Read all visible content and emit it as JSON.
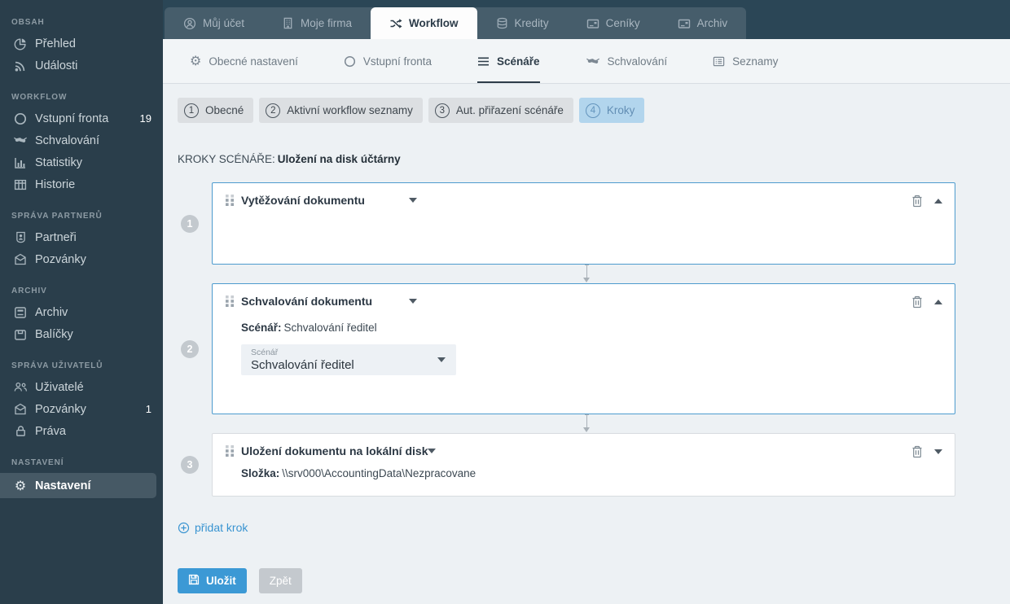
{
  "colors": {
    "sidebar_bg": "#2a3e4b",
    "topbar_bg": "#2b4656",
    "accent_blue": "#3c99d5",
    "active_pill_bg": "#b2d5ed",
    "card_border_active": "#4d9bce",
    "content_bg": "#edf1f4"
  },
  "icons": {
    "gear": "⚙"
  },
  "sidebar": {
    "sections": [
      {
        "header": "OBSAH",
        "items": [
          {
            "label": "Přehled",
            "icon": "pie-chart-icon"
          },
          {
            "label": "Události",
            "icon": "feed-icon"
          }
        ]
      },
      {
        "header": "WORKFLOW",
        "items": [
          {
            "label": "Vstupní fronta",
            "icon": "circle-icon",
            "badge": "19"
          },
          {
            "label": "Schvalování",
            "icon": "handshake-icon"
          },
          {
            "label": "Statistiky",
            "icon": "bar-chart-icon"
          },
          {
            "label": "Historie",
            "icon": "table-icon"
          }
        ]
      },
      {
        "header": "SPRÁVA PARTNERŮ",
        "items": [
          {
            "label": "Partneři",
            "icon": "person-badge-icon"
          },
          {
            "label": "Pozvánky",
            "icon": "envelope-icon"
          }
        ]
      },
      {
        "header": "ARCHIV",
        "items": [
          {
            "label": "Archiv",
            "icon": "archive-icon"
          },
          {
            "label": "Balíčky",
            "icon": "package-icon"
          }
        ]
      },
      {
        "header": "SPRÁVA UŽIVATELŮ",
        "items": [
          {
            "label": "Uživatelé",
            "icon": "users-icon"
          },
          {
            "label": "Pozvánky",
            "icon": "envelope-icon",
            "badge": "1"
          },
          {
            "label": "Práva",
            "icon": "lock-icon"
          }
        ]
      },
      {
        "header": "NASTAVENÍ",
        "items": [
          {
            "label": "Nastavení",
            "icon": "gear-icon",
            "active": true
          }
        ]
      }
    ]
  },
  "topbar": {
    "tabs": [
      {
        "label": "Můj účet",
        "icon": "user-circle-icon"
      },
      {
        "label": "Moje firma",
        "icon": "building-icon"
      },
      {
        "label": "Workflow",
        "icon": "shuffle-icon",
        "active": true
      },
      {
        "label": "Kredity",
        "icon": "coins-icon"
      },
      {
        "label": "Ceníky",
        "icon": "price-card-icon"
      },
      {
        "label": "Archiv",
        "icon": "archive-card-icon"
      }
    ]
  },
  "subnav": {
    "tabs": [
      {
        "label": "Obecné nastavení",
        "icon": "gear-icon"
      },
      {
        "label": "Vstupní fronta",
        "icon": "circle-icon"
      },
      {
        "label": "Scénáře",
        "icon": "lines-icon",
        "active": true
      },
      {
        "label": "Schvalování",
        "icon": "handshake-icon"
      },
      {
        "label": "Seznamy",
        "icon": "list-icon"
      }
    ]
  },
  "wizard": {
    "steps": [
      {
        "num": "1",
        "label": "Obecné"
      },
      {
        "num": "2",
        "label": "Aktivní workflow seznamy"
      },
      {
        "num": "3",
        "label": "Aut. přiřazení scénáře"
      },
      {
        "num": "4",
        "label": "Kroky",
        "active": true
      }
    ]
  },
  "page": {
    "heading_label": "KROKY SCÉNÁŘE:",
    "heading_value": "Uložení na disk účtárny"
  },
  "steps": [
    {
      "num": "1",
      "title": "Vytěžování dokumentu"
    },
    {
      "num": "2",
      "title": "Schvalování dokumentu",
      "summary_label": "Scénář:",
      "summary_value": "Schvalování ředitel",
      "field_label": "Scénář",
      "field_value": "Schvalování ředitel"
    },
    {
      "num": "3",
      "title": "Uložení dokumentu na lokální disk",
      "summary_label": "Složka:",
      "summary_value": "\\\\srv000\\AccountingData\\Nezpracovane"
    }
  ],
  "actions": {
    "add_step": "přidat krok",
    "save": "Uložit",
    "back": "Zpět"
  }
}
